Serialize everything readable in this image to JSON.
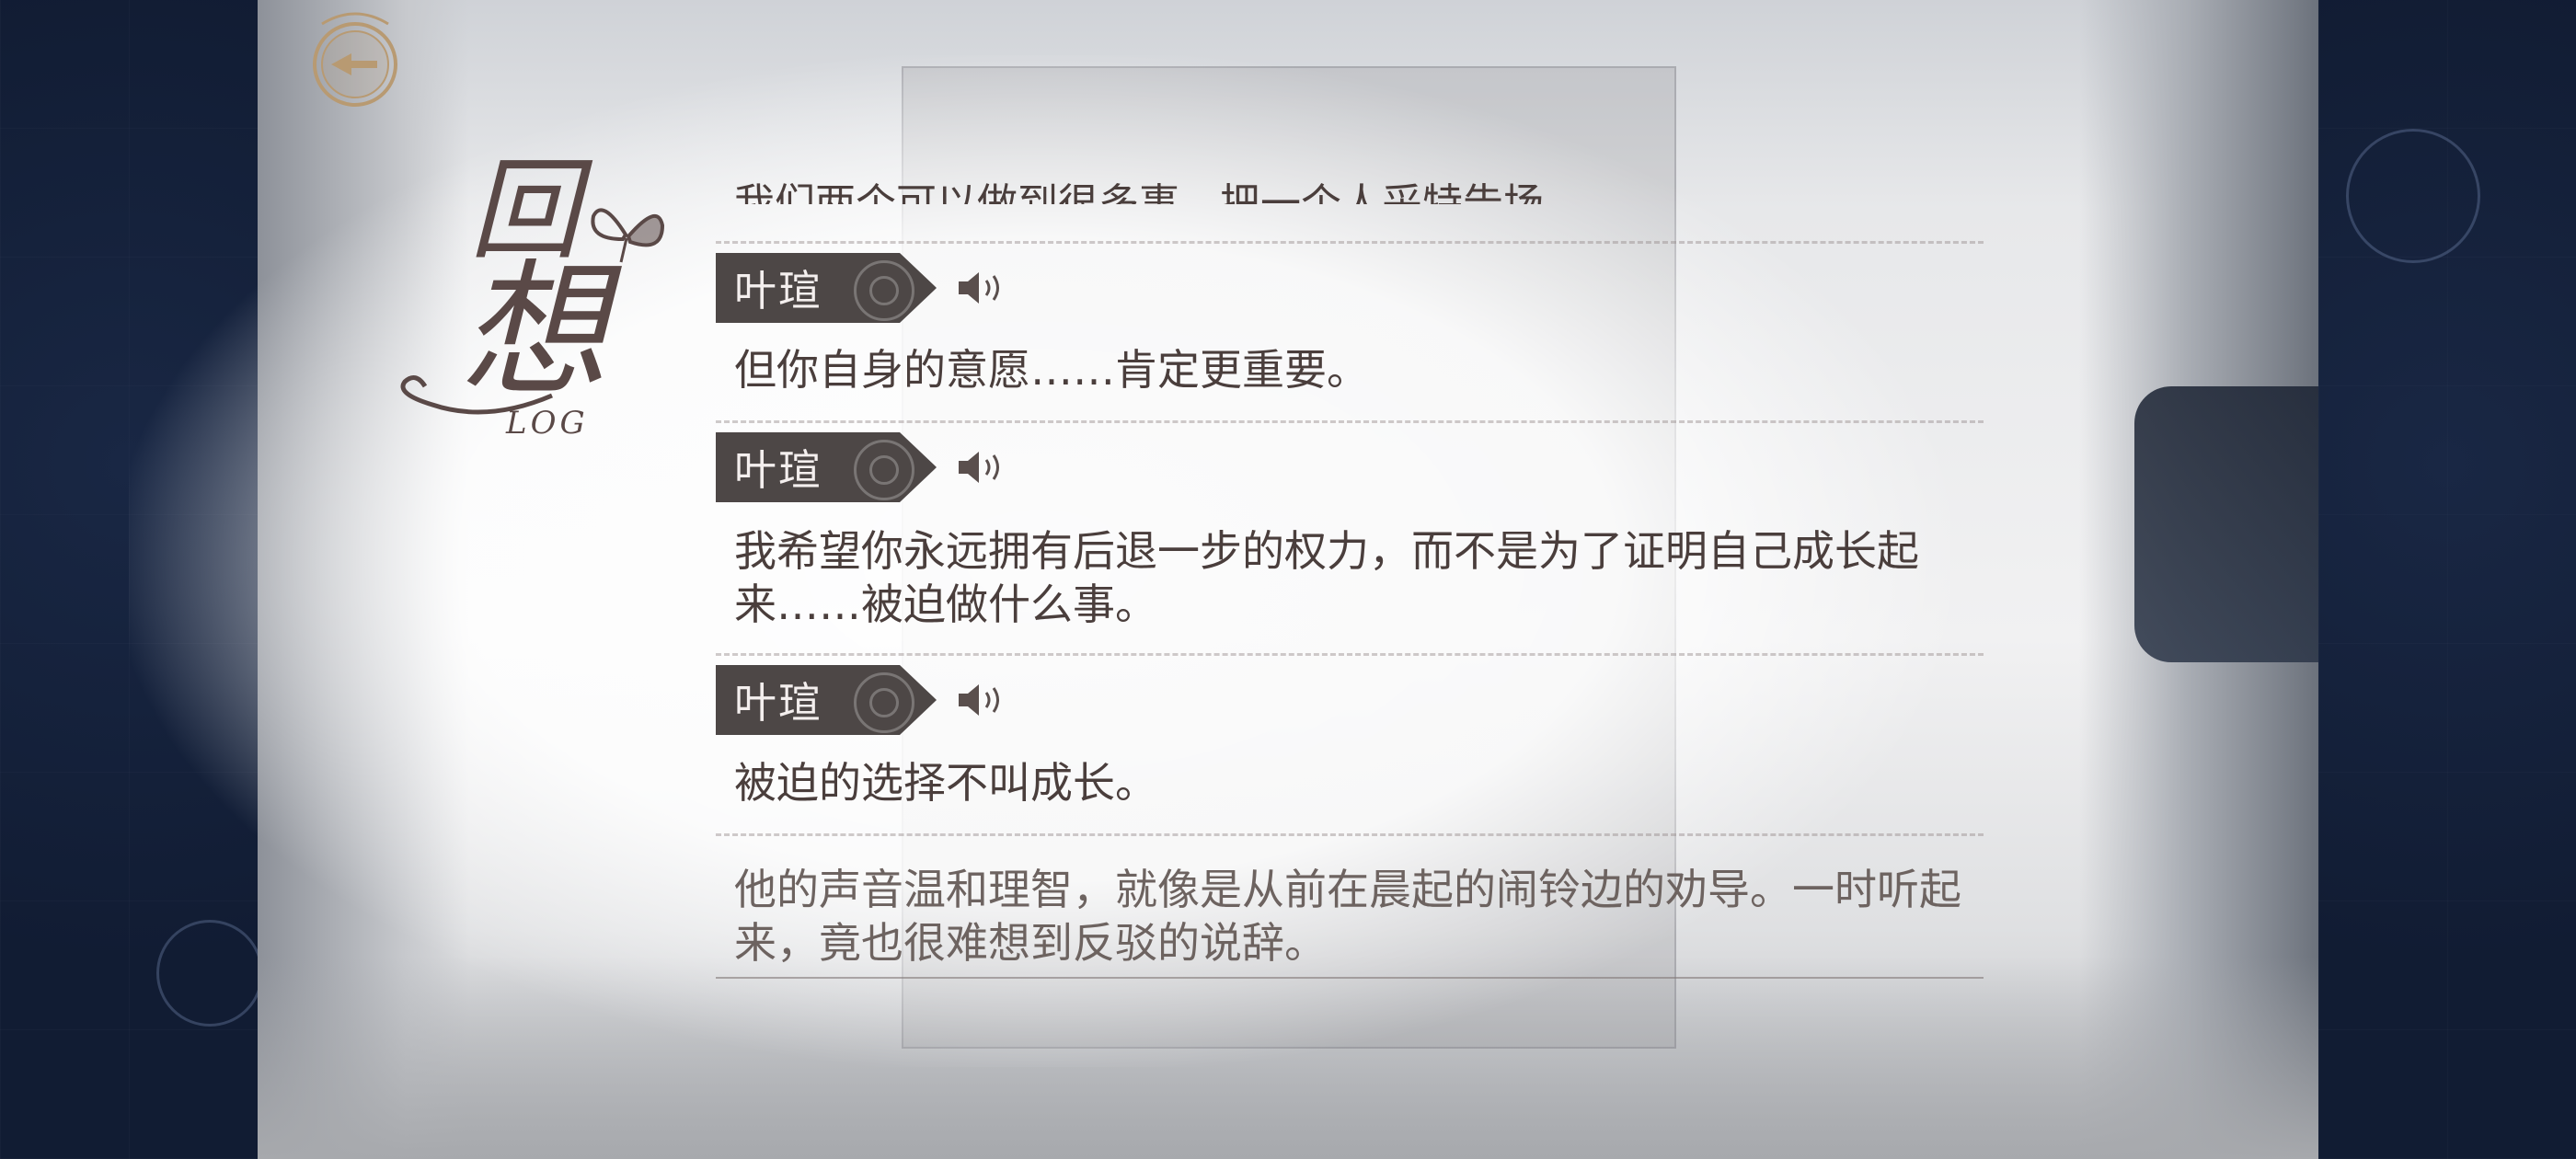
{
  "title": {
    "main_1": "回",
    "main_2": "想",
    "sub": "LOG"
  },
  "log": {
    "partial_top": "我们两个可以做到很多事，把一个人采特告场。",
    "entries": [
      {
        "speaker": "叶瑄",
        "text": "但你自身的意愿……肯定更重要。"
      },
      {
        "speaker": "叶瑄",
        "text": "我希望你永远拥有后退一步的权力，而不是为了证明自己成长起来……被迫做什么事。"
      },
      {
        "speaker": "叶瑄",
        "text": "被迫的选择不叫成长。"
      }
    ],
    "narration": "他的声音温和理智，就像是从前在晨起的闹铃边的劝导。一时听起来，竟也很难想到反驳的说辞。"
  },
  "colors": {
    "name_tag_bg": "#4d4746",
    "text": "#4a3e3c",
    "side_bg": "#111c33"
  },
  "icons": {
    "back": "back-arrow-icon",
    "voice": "speaker-icon",
    "butterfly": "butterfly-icon"
  }
}
